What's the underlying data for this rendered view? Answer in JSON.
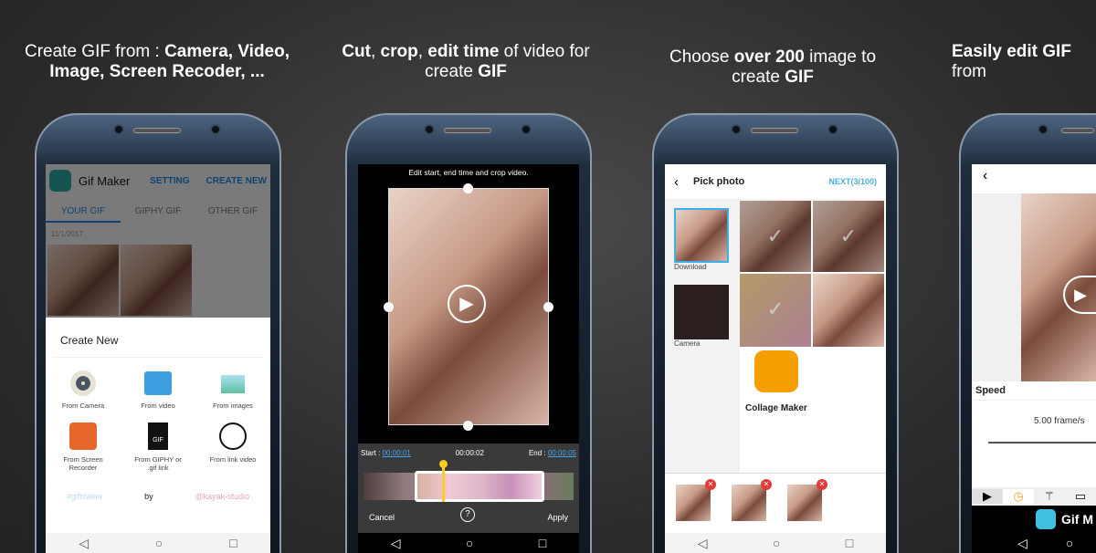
{
  "captions": [
    {
      "pre": "Create GIF from : ",
      "b1": "Camera, Video,",
      "mid": "",
      "b2": "Image, Screen Recoder, ...",
      "post": ""
    },
    {
      "b1": "Cut",
      "t1": ", ",
      "b2": "crop",
      "t2": ", ",
      "b3": "edit time",
      "t3": " of video for",
      "line2": "create ",
      "b4": "GIF"
    },
    {
      "t1": "Choose ",
      "b1": "over 200",
      "t2": " image to",
      "line2": "create ",
      "b2": "GIF"
    },
    {
      "b1": "Easily edit ",
      "b2": "GIF",
      "t1": " from"
    }
  ],
  "panel1": {
    "app_title": "Gif Maker",
    "setting": "SETTING",
    "create_new": "CREATE NEW",
    "tabs": [
      "YOUR GIF",
      "GIPHY GIF",
      "OTHER GIF"
    ],
    "date": "11/1/2017",
    "sheet_title": "Create New",
    "options": [
      "From Camera",
      "From video",
      "From images",
      "From Screen Recorder",
      "From GIPHY or .gif link",
      "From link video"
    ],
    "footer": {
      "tag": "#gifmaker",
      "by": "by",
      "studio": "@kayak-studio"
    },
    "accent": "#1e88e5"
  },
  "panel2": {
    "hint": "Edit start, end time and crop video.",
    "start_label": "Start : ",
    "start": "00:00:01",
    "current": "00:00:02",
    "end_label": "End : ",
    "end": "00:00:05",
    "cancel": "Cancel",
    "help": "?",
    "apply": "Apply"
  },
  "panel3": {
    "title": "Pick photo",
    "next": "NEXT(3/100)",
    "albums": [
      "Download",
      "Camera"
    ],
    "collage": "Collage Maker"
  },
  "panel4": {
    "speed_label": "Speed",
    "speed_value": "5.00 frame/s",
    "logo_text": "Gif M"
  },
  "nav_icons": [
    "back-icon",
    "home-icon",
    "recents-icon"
  ]
}
